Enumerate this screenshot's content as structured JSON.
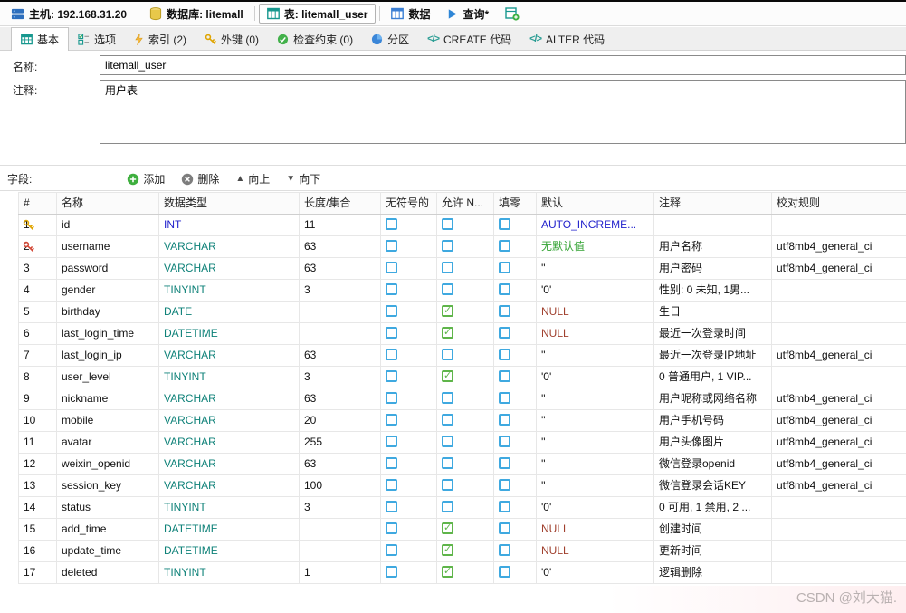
{
  "topbar": {
    "items": [
      {
        "label": "主机: 192.168.31.20",
        "icon": "host-server-icon"
      },
      {
        "label": "数据库: litemall",
        "icon": "database-cylinder-icon"
      },
      {
        "label": "表: litemall_user",
        "icon": "table-grid-icon"
      },
      {
        "label": "数据",
        "icon": "data-grid-icon"
      },
      {
        "label": "查询*",
        "icon": "query-play-icon"
      }
    ]
  },
  "tabs": [
    {
      "label": "基本",
      "active": true,
      "icon": "basic-grid-icon"
    },
    {
      "label": "选项",
      "active": false,
      "icon": "options-checklist-icon"
    },
    {
      "label": "索引 (2)",
      "active": false,
      "icon": "index-lightning-icon"
    },
    {
      "label": "外键 (0)",
      "active": false,
      "icon": "foreign-key-icon"
    },
    {
      "label": "检查约束 (0)",
      "active": false,
      "icon": "check-constraint-icon"
    },
    {
      "label": "分区",
      "active": false,
      "icon": "partition-sphere-icon"
    },
    {
      "label": "CREATE 代码",
      "active": false,
      "icon": "code-icon"
    },
    {
      "label": "ALTER 代码",
      "active": false,
      "icon": "code-icon"
    }
  ],
  "form": {
    "name_label": "名称:",
    "name_value": "litemall_user",
    "comment_label": "注释:",
    "comment_value": "用户表"
  },
  "fields_section": {
    "label": "字段:",
    "buttons": [
      {
        "label": "添加",
        "icon": "add-icon"
      },
      {
        "label": "删除",
        "icon": "delete-icon"
      },
      {
        "label": "向上",
        "icon": "move-up-icon"
      },
      {
        "label": "向下",
        "icon": "move-down-icon"
      }
    ]
  },
  "grid": {
    "columns": [
      "#",
      "名称",
      "数据类型",
      "长度/集合",
      "无符号的",
      "允许 N...",
      "填零",
      "默认",
      "注释",
      "校对规则"
    ],
    "rows": [
      {
        "num": "1",
        "key": "primary",
        "name": "id",
        "type": "INT",
        "length": "11",
        "length_disabled": false,
        "unsigned": false,
        "allow_null": false,
        "zerofill": false,
        "default": "AUTO_INCREME...",
        "default_style": "auto",
        "comment": "",
        "collation": "",
        "bold": true
      },
      {
        "num": "2",
        "key": "unique",
        "name": "username",
        "type": "VARCHAR",
        "length": "63",
        "length_disabled": false,
        "unsigned": false,
        "allow_null": false,
        "zerofill": false,
        "default": "无默认值",
        "default_style": "nodefault",
        "comment": "用户名称",
        "collation": "utf8mb4_general_ci",
        "bold": false
      },
      {
        "num": "3",
        "key": "",
        "name": "password",
        "type": "VARCHAR",
        "length": "63",
        "length_disabled": false,
        "unsigned": false,
        "allow_null": false,
        "zerofill": false,
        "default": "''",
        "default_style": "plain",
        "comment": "用户密码",
        "collation": "utf8mb4_general_ci",
        "bold": false
      },
      {
        "num": "4",
        "key": "",
        "name": "gender",
        "type": "TINYINT",
        "length": "3",
        "length_disabled": false,
        "unsigned": false,
        "allow_null": false,
        "zerofill": false,
        "default": "'0'",
        "default_style": "plain",
        "comment": "性别: 0 未知, 1男...",
        "collation": "",
        "bold": false
      },
      {
        "num": "5",
        "key": "",
        "name": "birthday",
        "type": "DATE",
        "length": "",
        "length_disabled": true,
        "unsigned": false,
        "allow_null": true,
        "zerofill": false,
        "default": "NULL",
        "default_style": "null",
        "comment": "生日",
        "collation": "",
        "bold": false
      },
      {
        "num": "6",
        "key": "",
        "name": "last_login_time",
        "type": "DATETIME",
        "length": "",
        "length_disabled": false,
        "unsigned": false,
        "allow_null": true,
        "zerofill": false,
        "default": "NULL",
        "default_style": "null",
        "comment": "最近一次登录时间",
        "collation": "",
        "bold": false
      },
      {
        "num": "7",
        "key": "",
        "name": "last_login_ip",
        "type": "VARCHAR",
        "length": "63",
        "length_disabled": false,
        "unsigned": false,
        "allow_null": false,
        "zerofill": false,
        "default": "''",
        "default_style": "plain",
        "comment": "最近一次登录IP地址",
        "collation": "utf8mb4_general_ci",
        "bold": false
      },
      {
        "num": "8",
        "key": "",
        "name": "user_level",
        "type": "TINYINT",
        "length": "3",
        "length_disabled": false,
        "unsigned": false,
        "allow_null": true,
        "zerofill": false,
        "default": "'0'",
        "default_style": "plain",
        "comment": "0 普通用户, 1 VIP...",
        "collation": "",
        "bold": false
      },
      {
        "num": "9",
        "key": "",
        "name": "nickname",
        "type": "VARCHAR",
        "length": "63",
        "length_disabled": false,
        "unsigned": false,
        "allow_null": false,
        "zerofill": false,
        "default": "''",
        "default_style": "plain",
        "comment": "用户昵称或网络名称",
        "collation": "utf8mb4_general_ci",
        "bold": false
      },
      {
        "num": "10",
        "key": "",
        "name": "mobile",
        "type": "VARCHAR",
        "length": "20",
        "length_disabled": false,
        "unsigned": false,
        "allow_null": false,
        "zerofill": false,
        "default": "''",
        "default_style": "plain",
        "comment": "用户手机号码",
        "collation": "utf8mb4_general_ci",
        "bold": false
      },
      {
        "num": "11",
        "key": "",
        "name": "avatar",
        "type": "VARCHAR",
        "length": "255",
        "length_disabled": false,
        "unsigned": false,
        "allow_null": false,
        "zerofill": false,
        "default": "''",
        "default_style": "plain",
        "comment": "用户头像图片",
        "collation": "utf8mb4_general_ci",
        "bold": false
      },
      {
        "num": "12",
        "key": "",
        "name": "weixin_openid",
        "type": "VARCHAR",
        "length": "63",
        "length_disabled": false,
        "unsigned": false,
        "allow_null": false,
        "zerofill": false,
        "default": "''",
        "default_style": "plain",
        "comment": "微信登录openid",
        "collation": "utf8mb4_general_ci",
        "bold": false
      },
      {
        "num": "13",
        "key": "",
        "name": "session_key",
        "type": "VARCHAR",
        "length": "100",
        "length_disabled": false,
        "unsigned": false,
        "allow_null": false,
        "zerofill": false,
        "default": "''",
        "default_style": "plain",
        "comment": "微信登录会话KEY",
        "collation": "utf8mb4_general_ci",
        "bold": false
      },
      {
        "num": "14",
        "key": "",
        "name": "status",
        "type": "TINYINT",
        "length": "3",
        "length_disabled": false,
        "unsigned": false,
        "allow_null": false,
        "zerofill": false,
        "default": "'0'",
        "default_style": "plain",
        "comment": "0 可用, 1 禁用, 2 ...",
        "collation": "",
        "bold": false
      },
      {
        "num": "15",
        "key": "",
        "name": "add_time",
        "type": "DATETIME",
        "length": "",
        "length_disabled": false,
        "unsigned": false,
        "allow_null": true,
        "zerofill": false,
        "default": "NULL",
        "default_style": "null",
        "comment": "创建时间",
        "collation": "",
        "bold": false
      },
      {
        "num": "16",
        "key": "",
        "name": "update_time",
        "type": "DATETIME",
        "length": "",
        "length_disabled": false,
        "unsigned": false,
        "allow_null": true,
        "zerofill": false,
        "default": "NULL",
        "default_style": "null",
        "comment": "更新时间",
        "collation": "",
        "bold": false
      },
      {
        "num": "17",
        "key": "",
        "name": "deleted",
        "type": "TINYINT",
        "length": "1",
        "length_disabled": false,
        "unsigned": false,
        "allow_null": true,
        "zerofill": false,
        "default": "'0'",
        "default_style": "plain",
        "comment": "逻辑删除",
        "collation": "",
        "bold": false
      }
    ]
  },
  "watermark": "CSDN @刘大猫.",
  "colors": {
    "type_color": "#0e8178",
    "auto_increment_color": "#2323cc",
    "no_default_color": "#33a333",
    "null_color": "#a0402e",
    "checkbox_blue": "#3fa9e0",
    "checkbox_green": "#5fb54a",
    "key_gold": "#dfa400",
    "key_red": "#d34836"
  }
}
